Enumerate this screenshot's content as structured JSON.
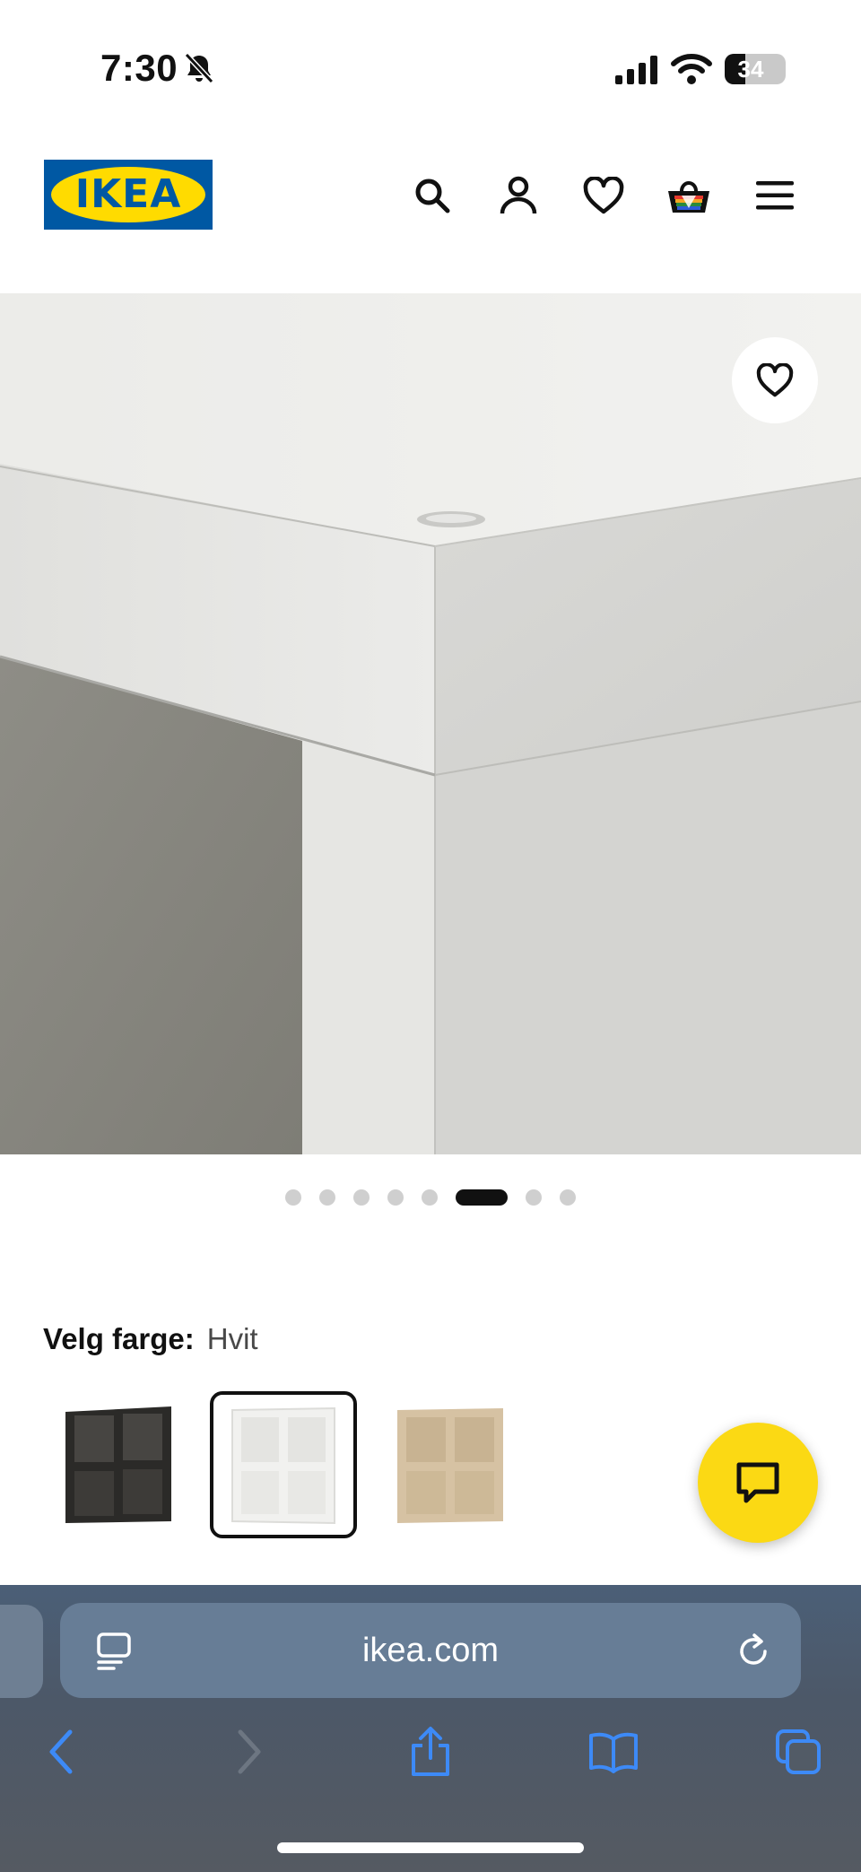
{
  "status_bar": {
    "time": "7:30",
    "battery_percent": "34",
    "battery_level": 0.34,
    "icons": [
      "bell-slash-icon",
      "signal-icon",
      "wifi-icon",
      "battery-icon"
    ]
  },
  "header": {
    "logo_text": "IKEA",
    "brand_colors": {
      "blue": "#0058a3",
      "yellow": "#ffdb00"
    },
    "icons": [
      "search-icon",
      "account-icon",
      "heart-icon",
      "basket-icon",
      "menu-icon"
    ]
  },
  "gallery": {
    "image_count": 8,
    "active_index": 5,
    "favorite_icon": "heart-icon"
  },
  "color_selector": {
    "label": "Velg farge:",
    "selected_value": "Hvit",
    "options": [
      "black-brown",
      "white",
      "white-stained-oak"
    ],
    "selected_index": 1
  },
  "chat": {
    "icon": "chat-bubble-icon",
    "color": "#fbd914"
  },
  "browser": {
    "url": "ikea.com",
    "icons": [
      "reader-icon",
      "reload-icon",
      "back-icon",
      "forward-icon",
      "share-icon",
      "bookmarks-icon",
      "tabs-icon"
    ],
    "accent": "#3d8af7"
  }
}
